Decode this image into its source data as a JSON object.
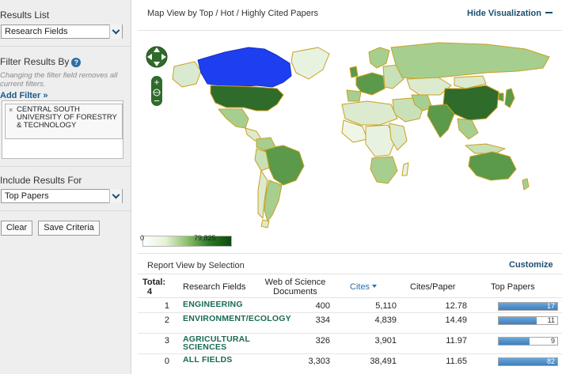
{
  "sidebar": {
    "results_list_label": "Results List",
    "results_list_value": "Research Fields",
    "filter_label": "Filter Results By",
    "filter_hint": "Changing the filter field removes all current filters.",
    "add_filter": "Add Filter »",
    "filter_chip": "CENTRAL SOUTH UNIVERSITY OF FORESTRY & TECHNOLOGY",
    "include_label": "Include Results For",
    "include_value": "Top Papers",
    "clear_button": "Clear",
    "save_button": "Save Criteria"
  },
  "map": {
    "title": "Map View by Top / Hot / Highly Cited Papers",
    "hide_link": "Hide Visualization",
    "legend_min": "0",
    "legend_max": "79,825",
    "colors": {
      "selected": "#1e3ff0",
      "dark": "#2f6b2a",
      "mid": "#5a9a4a",
      "light": "#a6cf8f",
      "pale": "#dcebd0",
      "border": "#c8a020"
    }
  },
  "report": {
    "title": "Report View by Selection",
    "customize": "Customize",
    "total_label": "Total:",
    "total_value": "4",
    "columns": {
      "field": "Research Fields",
      "docs": "Web of Science Documents",
      "cites": "Cites",
      "cites_per_paper": "Cites/Paper",
      "top_papers": "Top Papers"
    },
    "rows": [
      {
        "rank": "1",
        "field": "ENGINEERING",
        "docs": "400",
        "cites": "5,110",
        "cpp": "12.78",
        "top": "17",
        "top_fraction": 1.0
      },
      {
        "rank": "2",
        "field": "ENVIRONMENT/ECOLOGY",
        "docs": "334",
        "cites": "4,839",
        "cpp": "14.49",
        "top": "11",
        "top_fraction": 0.65
      },
      {
        "rank": "3",
        "field": "AGRICULTURAL SCIENCES",
        "docs": "326",
        "cites": "3,901",
        "cpp": "11.97",
        "top": "9",
        "top_fraction": 0.53
      },
      {
        "rank": "0",
        "field": "ALL FIELDS",
        "docs": "3,303",
        "cites": "38,491",
        "cpp": "11.65",
        "top": "82",
        "top_fraction": 1.0
      }
    ]
  }
}
